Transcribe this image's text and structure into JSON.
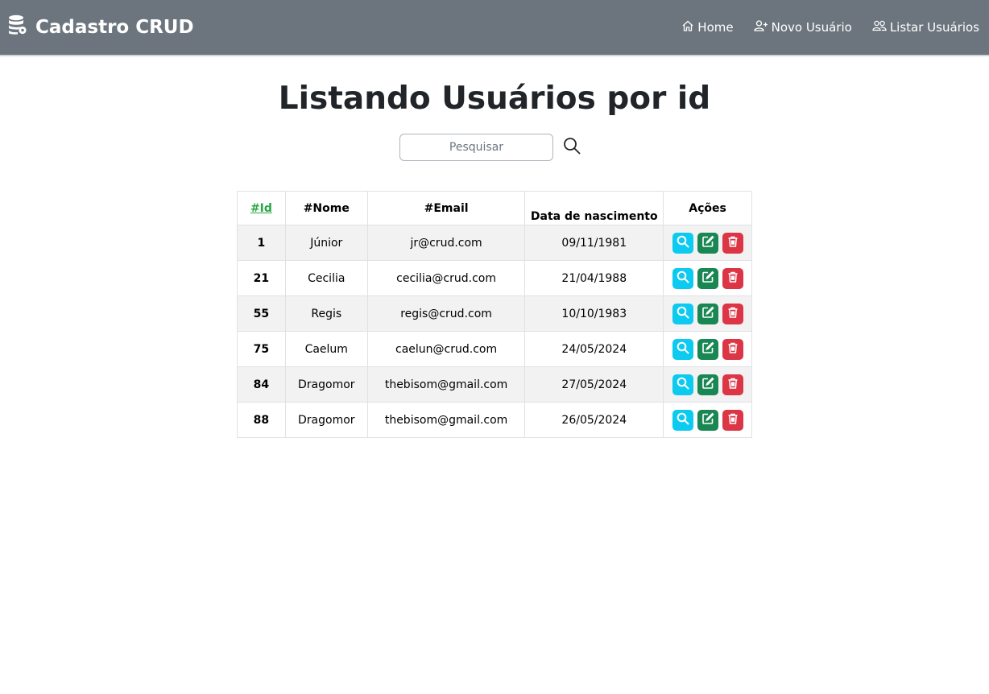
{
  "navbar": {
    "brand": "Cadastro CRUD",
    "links": [
      {
        "label": "Home",
        "icon": "house-icon"
      },
      {
        "label": "Novo Usuário",
        "icon": "person-plus-icon"
      },
      {
        "label": "Listar Usuários",
        "icon": "people-icon"
      }
    ]
  },
  "page": {
    "title": "Listando Usuários por id"
  },
  "search": {
    "placeholder": "Pesquisar",
    "value": ""
  },
  "table": {
    "headers": [
      "#Id",
      "#Nome",
      "#Email",
      "Data de nascimento",
      "Ações"
    ],
    "rows": [
      {
        "id": "1",
        "nome": "Júnior",
        "email": "jr@crud.com",
        "nascimento": "09/11/1981"
      },
      {
        "id": "21",
        "nome": "Cecilia",
        "email": "cecilia@crud.com",
        "nascimento": "21/04/1988"
      },
      {
        "id": "55",
        "nome": "Regis",
        "email": "regis@crud.com",
        "nascimento": "10/10/1983"
      },
      {
        "id": "75",
        "nome": "Caelum",
        "email": "caelun@crud.com",
        "nascimento": "24/05/2024"
      },
      {
        "id": "84",
        "nome": "Dragomor",
        "email": "thebisom@gmail.com",
        "nascimento": "27/05/2024"
      },
      {
        "id": "88",
        "nome": "Dragomor",
        "email": "thebisom@gmail.com",
        "nascimento": "26/05/2024"
      }
    ],
    "action_icons": [
      "search-icon",
      "edit-icon",
      "trash-icon"
    ]
  },
  "colors": {
    "navbar": "#6c757d",
    "sort_link": "#28a745",
    "view_button": "#0dcaf0",
    "edit_button": "#198754",
    "delete_button": "#dc3545"
  }
}
